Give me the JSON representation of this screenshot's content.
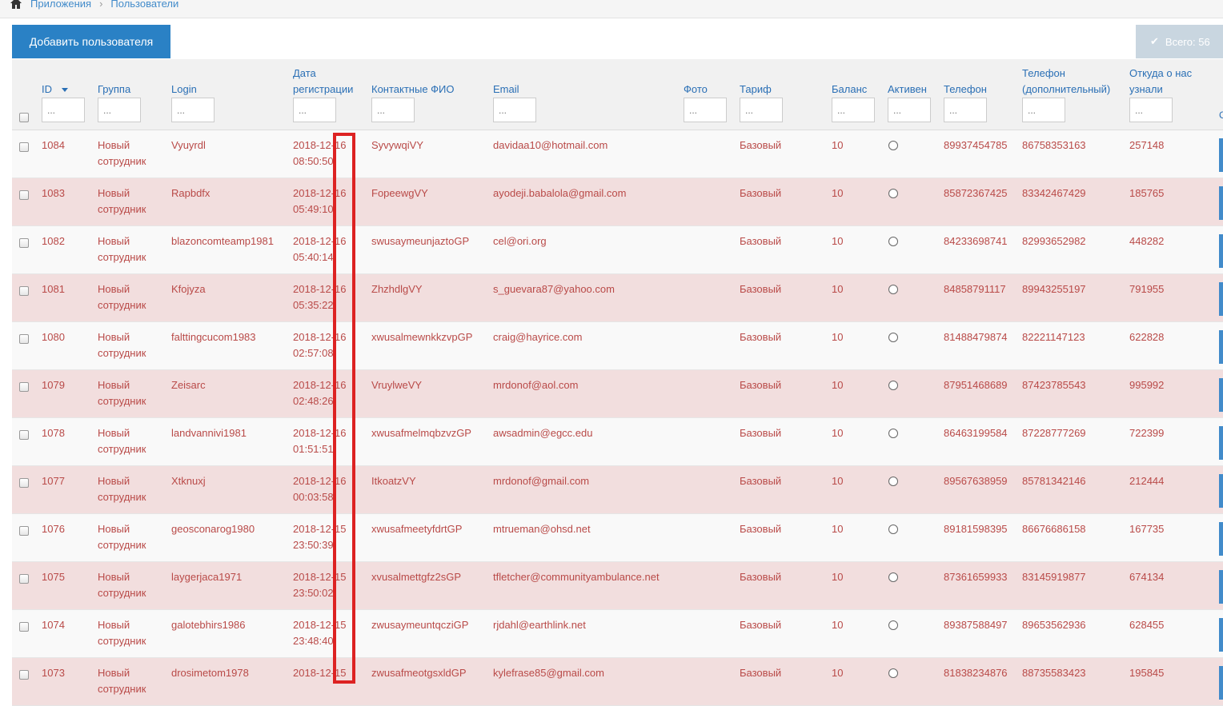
{
  "breadcrumb": {
    "home_icon": "home-icon",
    "items": [
      "Приложения",
      "Пользователи"
    ],
    "separator": "›"
  },
  "toolbar": {
    "add_label": "Добавить пользователя",
    "total_label": "Всего: 56"
  },
  "table": {
    "columns": [
      {
        "key": "id",
        "label": "ID",
        "placeholder": "..."
      },
      {
        "key": "group",
        "label": "Группа",
        "placeholder": "..."
      },
      {
        "key": "login",
        "label": "Login",
        "placeholder": "..."
      },
      {
        "key": "date_line1",
        "label": "Дата",
        "label2": "регистрации",
        "placeholder": "..."
      },
      {
        "key": "fio",
        "label": "Контактные ФИО",
        "placeholder": "..."
      },
      {
        "key": "email",
        "label": "Email",
        "placeholder": "..."
      },
      {
        "key": "photo",
        "label": "Фото",
        "placeholder": "..."
      },
      {
        "key": "tariff",
        "label": "Тариф",
        "placeholder": "..."
      },
      {
        "key": "balance",
        "label": "Баланс",
        "placeholder": "..."
      },
      {
        "key": "active",
        "label": "Активен",
        "placeholder": "..."
      },
      {
        "key": "phone",
        "label": "Телефон",
        "placeholder": "..."
      },
      {
        "key": "phone2",
        "label": "Телефон",
        "label2": "(дополнительный)",
        "placeholder": "..."
      },
      {
        "key": "source",
        "label": "Откуда о нас",
        "label2": "узнали",
        "placeholder": "..."
      }
    ],
    "cut_header": "С",
    "rows": [
      {
        "id": "1084",
        "group1": "Новый",
        "group2": "сотрудник",
        "login": "Vyuyrdl",
        "date": "2018-12-16",
        "time": "08:50:50",
        "fio": "SyvywqiVY",
        "email": "davidaa10@hotmail.com",
        "tariff": "Базовый",
        "balance": "10",
        "phone": "89937454785",
        "phone2": "86758353163",
        "source": "257148"
      },
      {
        "id": "1083",
        "group1": "Новый",
        "group2": "сотрудник",
        "login": "Rapbdfx",
        "date": "2018-12-16",
        "time": "05:49:10",
        "fio": "FopeewgVY",
        "email": "ayodeji.babalola@gmail.com",
        "tariff": "Базовый",
        "balance": "10",
        "phone": "85872367425",
        "phone2": "83342467429",
        "source": "185765"
      },
      {
        "id": "1082",
        "group1": "Новый",
        "group2": "сотрудник",
        "login": "blazoncomteamp1981",
        "date": "2018-12-16",
        "time": "05:40:14",
        "fio": "swusaymeunjaztoGP",
        "email": "cel@ori.org",
        "tariff": "Базовый",
        "balance": "10",
        "phone": "84233698741",
        "phone2": "82993652982",
        "source": "448282"
      },
      {
        "id": "1081",
        "group1": "Новый",
        "group2": "сотрудник",
        "login": "Kfojyza",
        "date": "2018-12-16",
        "time": "05:35:22",
        "fio": "ZhzhdlgVY",
        "email": "s_guevara87@yahoo.com",
        "tariff": "Базовый",
        "balance": "10",
        "phone": "84858791117",
        "phone2": "89943255197",
        "source": "791955"
      },
      {
        "id": "1080",
        "group1": "Новый",
        "group2": "сотрудник",
        "login": "falttingcucom1983",
        "date": "2018-12-16",
        "time": "02:57:08",
        "fio": "xwusalmewnkkzvpGP",
        "email": "craig@hayrice.com",
        "tariff": "Базовый",
        "balance": "10",
        "phone": "81488479874",
        "phone2": "82221147123",
        "source": "622828"
      },
      {
        "id": "1079",
        "group1": "Новый",
        "group2": "сотрудник",
        "login": "Zeisarc",
        "date": "2018-12-16",
        "time": "02:48:26",
        "fio": "VruylweVY",
        "email": "mrdonof@aol.com",
        "tariff": "Базовый",
        "balance": "10",
        "phone": "87951468689",
        "phone2": "87423785543",
        "source": "995992"
      },
      {
        "id": "1078",
        "group1": "Новый",
        "group2": "сотрудник",
        "login": "landvannivi1981",
        "date": "2018-12-16",
        "time": "01:51:51",
        "fio": "xwusafmelmqbzvzGP",
        "email": "awsadmin@egcc.edu",
        "tariff": "Базовый",
        "balance": "10",
        "phone": "86463199584",
        "phone2": "87228777269",
        "source": "722399"
      },
      {
        "id": "1077",
        "group1": "Новый",
        "group2": "сотрудник",
        "login": "Xtknuxj",
        "date": "2018-12-16",
        "time": "00:03:58",
        "fio": "ItkoatzVY",
        "email": "mrdonof@gmail.com",
        "tariff": "Базовый",
        "balance": "10",
        "phone": "89567638959",
        "phone2": "85781342146",
        "source": "212444"
      },
      {
        "id": "1076",
        "group1": "Новый",
        "group2": "сотрудник",
        "login": "geosconarog1980",
        "date": "2018-12-15",
        "time": "23:50:39",
        "fio": "xwusafmeetyfdrtGP",
        "email": "mtrueman@ohsd.net",
        "tariff": "Базовый",
        "balance": "10",
        "phone": "89181598395",
        "phone2": "86676686158",
        "source": "167735"
      },
      {
        "id": "1075",
        "group1": "Новый",
        "group2": "сотрудник",
        "login": "laygerjaca1971",
        "date": "2018-12-15",
        "time": "23:50:02",
        "fio": "xvusalmettgfz2sGP",
        "email": "tfletcher@communityambulance.net",
        "tariff": "Базовый",
        "balance": "10",
        "phone": "87361659933",
        "phone2": "83145919877",
        "source": "674134"
      },
      {
        "id": "1074",
        "group1": "Новый",
        "group2": "сотрудник",
        "login": "galotebhirs1986",
        "date": "2018-12-15",
        "time": "23:48:40",
        "fio": "zwusaymeuntqcziGP",
        "email": "rjdahl@earthlink.net",
        "tariff": "Базовый",
        "balance": "10",
        "phone": "89387588497",
        "phone2": "89653562936",
        "source": "628455"
      },
      {
        "id": "1073",
        "group1": "Новый",
        "group2": "сотрудник",
        "login": "drosimetom1978",
        "date": "2018-12-15",
        "time": "",
        "fio": "zwusafmeotgsxldGP",
        "email": "kylefrase85@gmail.com",
        "tariff": "Базовый",
        "balance": "10",
        "phone": "81838234876",
        "phone2": "88735583423",
        "source": "195845"
      }
    ]
  },
  "colors": {
    "accent": "#2a81c5",
    "link": "#2a6fb5",
    "row_text": "#b94a48",
    "row_alt": "#f2dede",
    "highlight_box": "#dd2222"
  }
}
